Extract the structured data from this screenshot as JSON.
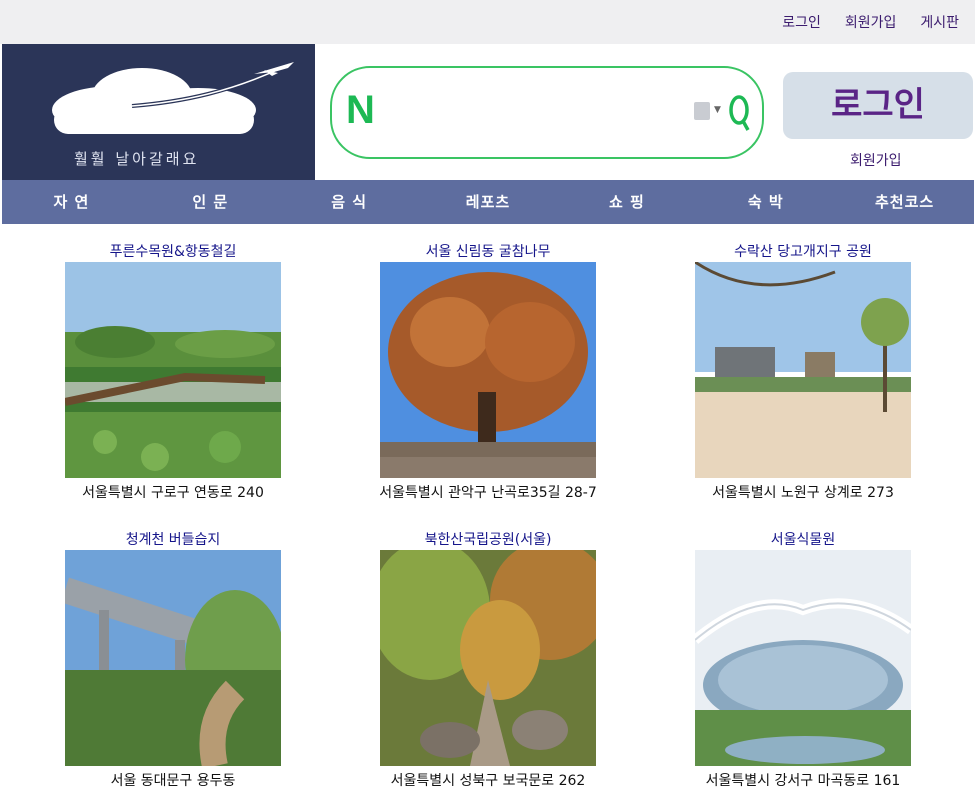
{
  "topbar": {
    "login": "로그인",
    "signup": "회원가입",
    "board": "게시판"
  },
  "logo": {
    "tagline": "훨훨 날아갈래요"
  },
  "search": {
    "brand": "N",
    "placeholder": ""
  },
  "account": {
    "login_button": "로그인",
    "signup_link": "회원가입"
  },
  "nav": {
    "items": [
      "자 연",
      "인 문",
      "음 식",
      "레포츠",
      "쇼 핑",
      "숙 박",
      "추천코스"
    ]
  },
  "places": [
    {
      "title": "푸른수목원&항동철길",
      "address": "서울특별시 구로구 연동로 240"
    },
    {
      "title": "서울 신림동 굴참나무",
      "address": "서울특별시 관악구 난곡로35길 28-7"
    },
    {
      "title": "수락산 당고개지구 공원",
      "address": "서울특별시 노원구 상계로 273"
    },
    {
      "title": "청계천 버들습지",
      "address": "서울 동대문구 용두동"
    },
    {
      "title": "북한산국립공원(서울)",
      "address": "서울특별시 성북구 보국문로 262"
    },
    {
      "title": "서울식물원",
      "address": "서울특별시 강서구 마곡동로 161"
    }
  ],
  "colors": {
    "brand_dark": "#2b3558",
    "nav_bg": "#5e6d9f",
    "accent_green": "#1db954",
    "title_blue": "#15158a"
  }
}
